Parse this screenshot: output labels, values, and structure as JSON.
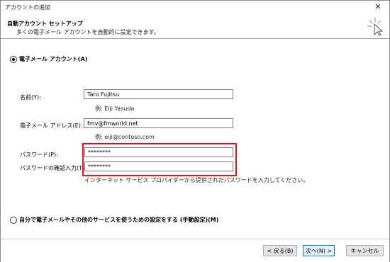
{
  "window": {
    "title": "アカウントの追加",
    "close_symbol": "✕"
  },
  "header": {
    "title": "自動アカウント セットアップ",
    "subtitle": "多くの電子メール アカウントを自動的に設定できます。"
  },
  "email_account_option": {
    "label": "電子メール アカウント(A)",
    "selected": true
  },
  "fields": {
    "name": {
      "label": "名前(Y):",
      "value": "Taro Fujitsu",
      "example": "例: Eiji Yasuda"
    },
    "email": {
      "label": "電子メール アドレス(E):",
      "value": "fmv@fmworld.net",
      "example": "例: eiji@contoso.com"
    },
    "password": {
      "label": "パスワード(P):",
      "value": "********"
    },
    "password_confirm": {
      "label": "パスワードの確認入力(T):",
      "value": "********"
    },
    "password_note": "インターネット サービス プロバイダーから提供されたパスワードを入力してください。"
  },
  "manual_option": {
    "label": "自分で電子メールやその他のサービスを使うための設定をする (手動設定)(M)",
    "selected": false
  },
  "buttons": {
    "back": "< 戻る(B)",
    "next": "次へ(N) >",
    "cancel": "キャンセル"
  },
  "icons": {
    "wizard": "wizard-sparkle-cursor-icon",
    "close": "close-icon"
  },
  "colors": {
    "highlight": "#e0141a",
    "default_button_border": "#0078d7"
  }
}
